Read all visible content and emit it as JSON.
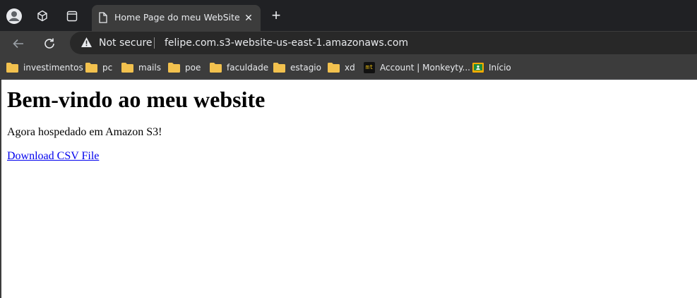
{
  "browser": {
    "tab": {
      "title": "Home Page do meu WebSite",
      "close_glyph": "✕",
      "icon": "page-icon"
    },
    "new_tab_glyph": "+",
    "address_bar": {
      "security_label": "Not secure",
      "url": "felipe.com.s3-website-us-east-1.amazonaws.com"
    },
    "bookmarks": [
      {
        "label": "investimentos",
        "icon": "folder-icon"
      },
      {
        "label": "pc",
        "icon": "folder-icon"
      },
      {
        "label": "mails",
        "icon": "folder-icon"
      },
      {
        "label": "poe",
        "icon": "folder-icon"
      },
      {
        "label": "faculdade",
        "icon": "folder-icon"
      },
      {
        "label": "estagio",
        "icon": "folder-icon"
      },
      {
        "label": "xd",
        "icon": "folder-icon"
      },
      {
        "label": "Account | Monkeyty...",
        "icon": "monkeytype-icon",
        "icon_text": "mt"
      },
      {
        "label": "Início",
        "icon": "google-classroom-icon"
      }
    ],
    "colors": {
      "frame": "#202124",
      "toolbar": "#3c3c3c",
      "omnibox": "#282828",
      "folder": "#f2c14e",
      "link": "#0000ee"
    }
  },
  "page": {
    "heading": "Bem-vindo ao meu website",
    "paragraph": "Agora hospedado em Amazon S3!",
    "link": "Download CSV File"
  }
}
